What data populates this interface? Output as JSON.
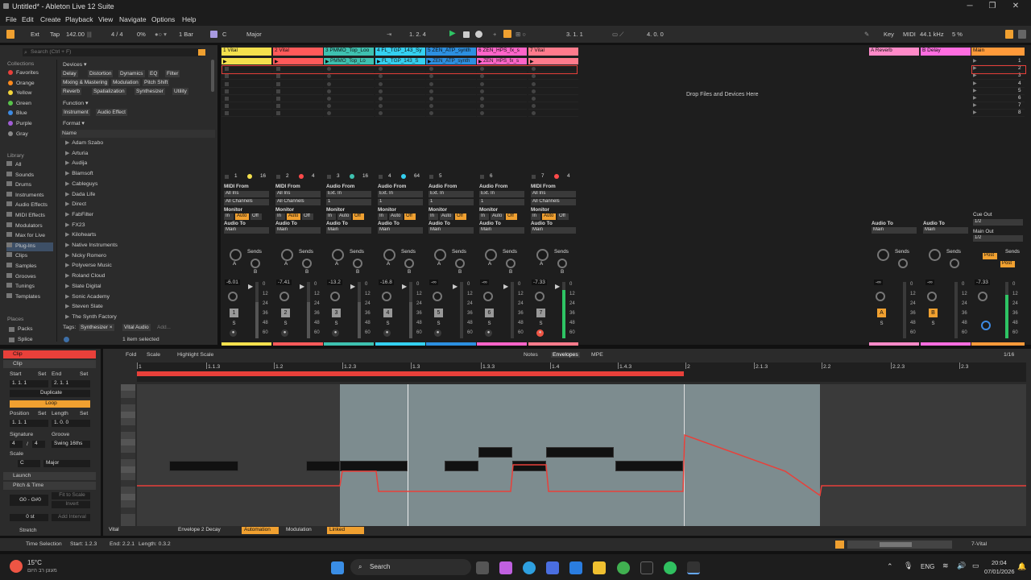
{
  "window": {
    "title": "Untitled* - Ableton Live 12 Suite",
    "minimize": "─",
    "maximize": "❐",
    "close": "✕"
  },
  "menu": [
    "File",
    "Edit",
    "Create",
    "Playback",
    "View",
    "Navigate",
    "Options",
    "Help"
  ],
  "control": {
    "ext": "Ext",
    "tap": "Tap",
    "tempo": "142.00",
    "signature": "4 / 4",
    "swing": "0%",
    "quantize": "1 Bar",
    "scale_root": "C",
    "scale_mode": "Major",
    "arrangement_pos": "1.  2.  4",
    "loop_start": "3.  1.  1",
    "loop_length": "4.  0.  0",
    "key": "Key",
    "midi": "MIDI",
    "sample_rate": "44.1 kHz",
    "cpu": "5 %"
  },
  "browser": {
    "search_placeholder": "Search (Ctrl + F)",
    "collections_title": "Collections",
    "collections": [
      {
        "label": "Favorites",
        "color": "#e8403a"
      },
      {
        "label": "Orange",
        "color": "#ff8a1c"
      },
      {
        "label": "Yellow",
        "color": "#f3d43a"
      },
      {
        "label": "Green",
        "color": "#58c34a"
      },
      {
        "label": "Blue",
        "color": "#3d8ae3"
      },
      {
        "label": "Purple",
        "color": "#a15dd6"
      },
      {
        "label": "Gray",
        "color": "#8a8a8a"
      }
    ],
    "library_title": "Library",
    "library": [
      "All",
      "Sounds",
      "Drums",
      "Instruments",
      "Audio Effects",
      "MIDI Effects",
      "Modulators",
      "Max for Live",
      "Plug-Ins",
      "Clips",
      "Samples",
      "Grooves",
      "Tunings",
      "Templates"
    ],
    "places_title": "Places",
    "places": [
      "Packs",
      "Splice"
    ],
    "devices_filter": "Devices ▾",
    "device_tags": [
      "Delay",
      "Distortion",
      "Dynamics",
      "EQ",
      "Filter",
      "Mixing & Mastering",
      "Modulation",
      "Pitch Shift",
      "Reverb",
      "Spatialization",
      "Synthesizer",
      "Utility"
    ],
    "function_filter": "Function ▾",
    "function_tags": [
      "Instrument",
      "Audio Effect"
    ],
    "format_filter": "Format ▾",
    "name_header": "Name",
    "plugins": [
      "Adam Szabo",
      "Arturia",
      "Audija",
      "Blamsoft",
      "Cableguys",
      "Dada Life",
      "Direct",
      "FabFilter",
      "FX23",
      "Kilohearts",
      "Native Instruments",
      "Nicky Romero",
      "Polyverse Music",
      "Roland Cloud",
      "Slate Digital",
      "Sonic Academy",
      "Steven Slate",
      "The Synth Factory"
    ],
    "tags_label": "Tags:",
    "tag_chips": [
      "Synthesizer ×",
      "Vital Audio",
      "Add..."
    ],
    "selection_status": "1 item selected"
  },
  "tracks": [
    {
      "name": "1 Vital",
      "color": "#f4e04d",
      "clip": "",
      "clip_color": "#f4e04d",
      "type": "midi",
      "from": "All Ins",
      "channel": "All Channels",
      "to": "Main",
      "vol": "-6.01",
      "num": "1",
      "arm_dot": "#f4e04d",
      "dev": "16"
    },
    {
      "name": "2 Vital",
      "color": "#ff5a5a",
      "clip": "",
      "clip_color": "#ff5a5a",
      "type": "midi",
      "from": "All Ins",
      "channel": "All Channels",
      "to": "Main",
      "vol": "-7.41",
      "num": "2",
      "arm_dot": "#ff4a4a",
      "dev": "4"
    },
    {
      "name": "3 PMMO_Top_Loo",
      "color": "#3ec1b0",
      "clip": "PMMO_Top_Lo",
      "clip_color": "#3ec1b0",
      "type": "audio",
      "from": "Ext. In",
      "channel": "1",
      "to": "Main",
      "vol": "-13.2",
      "num": "3",
      "arm_dot": "#3ec1b0",
      "dev": "16"
    },
    {
      "name": "4 FL_TGP_143_Sy",
      "color": "#34d0f0",
      "clip": "FL_TGP_143_S",
      "clip_color": "#34d0f0",
      "type": "audio",
      "from": "Ext. In",
      "channel": "1",
      "to": "Main",
      "vol": "-16.8",
      "num": "4",
      "arm_dot": "#34d0f0",
      "dev": "64"
    },
    {
      "name": "5 ZEN_ATP_synth",
      "color": "#2c8fe0",
      "clip": "ZEN_ATP_synth",
      "clip_color": "#2c8fe0",
      "type": "audio",
      "from": "Ext. In",
      "channel": "1",
      "to": "Main",
      "vol": "-∞",
      "num": "5",
      "arm_dot": "",
      "dev": ""
    },
    {
      "name": "6 ZEN_HPS_fx_s",
      "color": "#ff64c8",
      "clip": "ZEN_HPS_fx_s",
      "clip_color": "#ff64c8",
      "type": "audio",
      "from": "Ext. In",
      "channel": "1",
      "to": "Main",
      "vol": "-∞",
      "num": "6",
      "arm_dot": "",
      "dev": ""
    },
    {
      "name": "7 Vital",
      "color": "#ff7b8c",
      "clip": "",
      "clip_color": "#ff7b8c",
      "type": "midi",
      "from": "All Ins",
      "channel": "All Channels",
      "to": "Main",
      "vol": "-7.33",
      "num": "7",
      "arm_dot": "#ff4a4a",
      "dev": "4"
    }
  ],
  "returns": [
    {
      "name": "A Reverb",
      "color": "#ff8ac8",
      "to": "Main",
      "letter": "A",
      "vol": "-∞"
    },
    {
      "name": "B Delay",
      "color": "#ff6de0",
      "to": "Main",
      "letter": "B",
      "vol": "-∞"
    }
  ],
  "main": {
    "name": "Main",
    "color": "#ff9a3a",
    "cue_label": "Cue Out",
    "cue": "1/2",
    "out_label": "Main Out",
    "out": "1/2",
    "vol": "-7.33",
    "scenes": [
      "1",
      "2",
      "3",
      "4",
      "5",
      "6",
      "7",
      "8"
    ]
  },
  "mixer": {
    "midi_from": "MIDI From",
    "audio_from": "Audio From",
    "monitor": "Monitor",
    "monitor_in": "In",
    "monitor_auto": "Auto",
    "monitor_off": "Off",
    "audio_to": "Audio To",
    "sends": "Sends",
    "send_a": "A",
    "send_b": "B",
    "post": "Post",
    "solo": "S",
    "meter_ticks": [
      "0",
      "12",
      "24",
      "36",
      "48",
      "60"
    ]
  },
  "drop_hint": "Drop Files and Devices Here",
  "clip": {
    "title": "Clip",
    "section": "Clip",
    "start": "Start",
    "set": "Set",
    "end": "End",
    "start_val": "1.  1.  1",
    "end_val": "2.  1.  1",
    "duplicate": "Duplicate",
    "loop": "Loop",
    "position": "Position",
    "length": "Length",
    "position_val": "1.  1.  1",
    "length_val": "1.  0.  0",
    "signature": "Signature",
    "groove": "Groove",
    "sig_num": "4",
    "sig_den": "4",
    "groove_val": "Swing 16ths",
    "scale": "Scale",
    "scale_root": "C",
    "scale_mode": "Major",
    "launch": "Launch",
    "pitch_time": "Pitch & Time",
    "range": "G0 - G#0",
    "fit_to_scale": "Fit to Scale",
    "invert": "Invert",
    "semitones": "0 st",
    "add_interval": "Add Interval",
    "stretch": "Stretch"
  },
  "editor": {
    "fold": "Fold",
    "scale": "Scale",
    "highlight": "Highlight Scale",
    "tab_notes": "Notes",
    "tab_envelopes": "Envelopes",
    "tab_mpe": "MPE",
    "grid": "1/16",
    "ruler": [
      "1",
      "1.1.3",
      "1.2",
      "1.2.3",
      "1.3",
      "1.3.3",
      "1.4",
      "1.4.3",
      "2",
      "2.1.3",
      "2.2",
      "2.2.3",
      "2.3"
    ],
    "device": "Vital",
    "param": "Envelope 2 Decay",
    "automation_btn": "Automation",
    "modulation_btn": "Modulation",
    "linked_btn": "Linked"
  },
  "status": {
    "text": "Time Selection",
    "start": "Start: 1.2.3",
    "end": "End: 2.2.1",
    "length": "Length: 0.3.2",
    "track": "7-Vital"
  },
  "taskbar": {
    "weather": "15°C",
    "weather_sub": "מעונן רב היום",
    "search": "Search",
    "lang": "ENG",
    "time": "20:04",
    "date": "07/01/2026"
  }
}
